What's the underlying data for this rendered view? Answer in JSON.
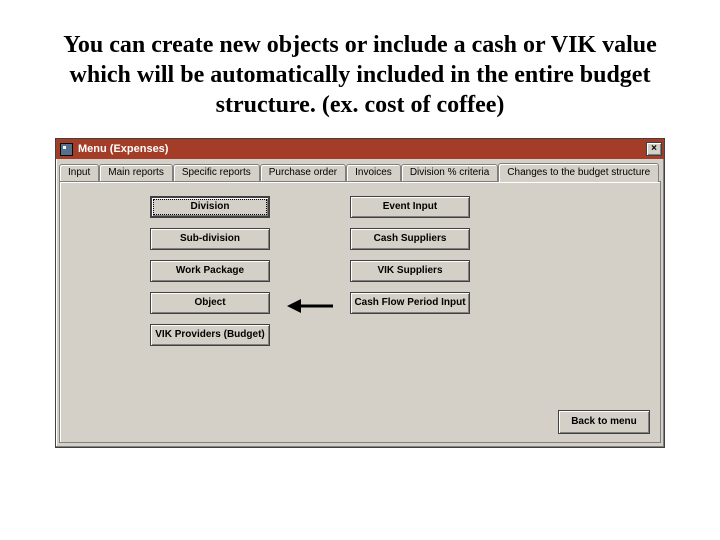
{
  "heading": "You can create new objects or include a cash or VIK value which will be automatically included in the entire budget structure. (ex. cost of coffee)",
  "window": {
    "title": "Menu (Expenses)",
    "close_label": "×"
  },
  "tabs": [
    {
      "label": "Input"
    },
    {
      "label": "Main reports"
    },
    {
      "label": "Specific reports"
    },
    {
      "label": "Purchase order"
    },
    {
      "label": "Invoices"
    },
    {
      "label": "Division % criteria"
    },
    {
      "label": "Changes to the budget structure"
    }
  ],
  "buttons": {
    "colA": [
      "Division",
      "Sub-division",
      "Work Package",
      "Object",
      "VIK Providers (Budget)"
    ],
    "colB": [
      "Event Input",
      "Cash Suppliers",
      "VIK Suppliers",
      "Cash Flow Period Input"
    ]
  },
  "back_label": "Back to menu"
}
